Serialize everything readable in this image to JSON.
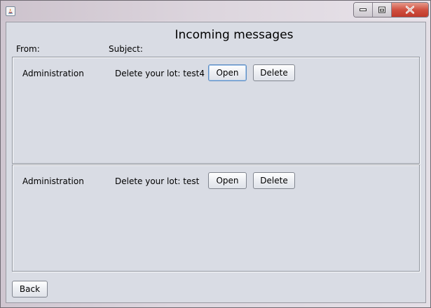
{
  "window": {
    "title": ""
  },
  "header": {
    "title": "Incoming messages",
    "from_label": "From:",
    "subject_label": "Subject:"
  },
  "messages": [
    {
      "sender": "Administration",
      "subject": "Delete your lot: test4",
      "open_label": "Open",
      "delete_label": "Delete",
      "focused": true
    },
    {
      "sender": "Administration",
      "subject": "Delete your lot: test",
      "open_label": "Open",
      "delete_label": "Delete",
      "focused": false
    }
  ],
  "footer": {
    "back_label": "Back"
  },
  "icons": {
    "app": "java-icon",
    "minimize": "minimize-icon",
    "maximize": "maximize-icon",
    "close": "close-icon"
  },
  "colors": {
    "close_button": "#c0392b",
    "focus_border": "#5a8bc2",
    "panel_background": "#d9dce4"
  }
}
